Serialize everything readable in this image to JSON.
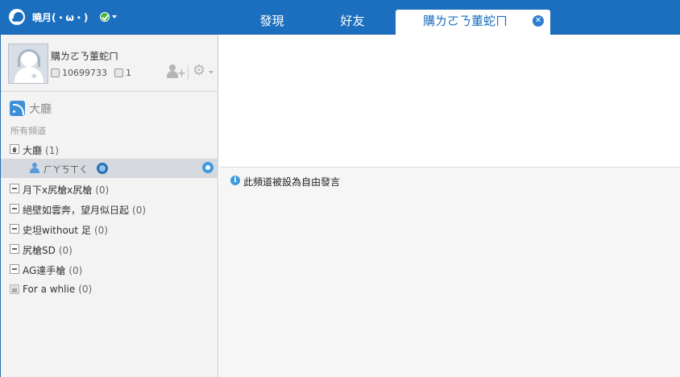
{
  "topbar": {
    "username": "曉月(・ω・)",
    "tabs": [
      {
        "label": "發現"
      },
      {
        "label": "好友"
      },
      {
        "label": "購ㄌㄛㄋ董蛇ㄇ"
      }
    ]
  },
  "profile": {
    "nickname": "購ㄌㄛㄋ董蛇ㄇ",
    "user_id": "10699733",
    "count": "1"
  },
  "sidebar": {
    "lobby_title": "大廳",
    "all_channels_label": "所有頻道",
    "channels": [
      {
        "name": "大廳",
        "count": "(1)"
      },
      {
        "name": "月下x尻槍x尻槍",
        "count": "(0)"
      },
      {
        "name": "絕壁如雲奔，望月似日起",
        "count": "(0)"
      },
      {
        "name": "史坦without 足",
        "count": "(0)"
      },
      {
        "name": "尻槍SD",
        "count": "(0)"
      },
      {
        "name": "AG達手槍",
        "count": "(0)"
      },
      {
        "name": "For a whlie",
        "count": "(0)"
      }
    ],
    "member": {
      "name": "ㄏㄚㄎㄒㄑ"
    }
  },
  "main": {
    "notice": "此頻道被設為自由發言"
  },
  "colors": {
    "brand": "#1c6fbf",
    "status_online": "#3fb83a",
    "accent": "#3d9ae2"
  }
}
